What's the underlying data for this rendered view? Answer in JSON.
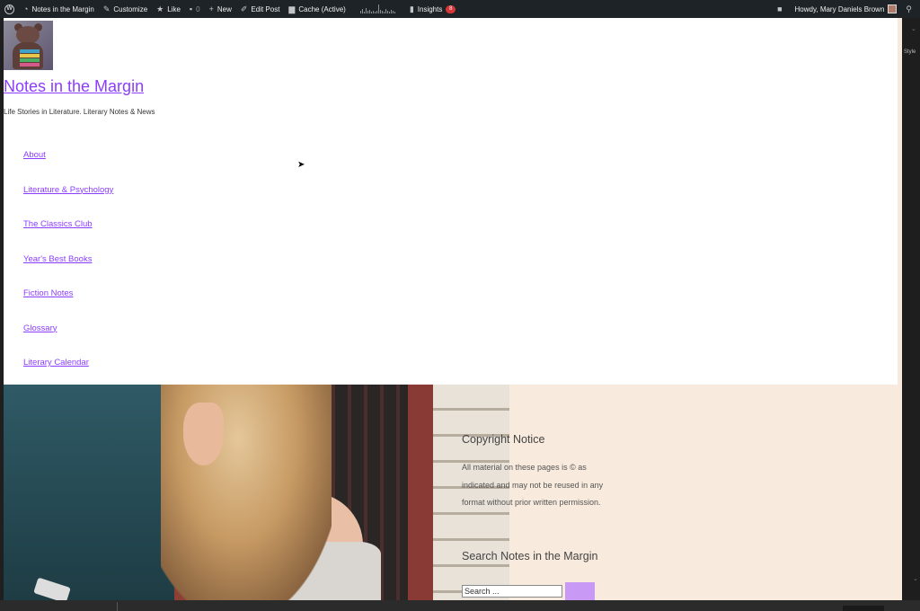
{
  "admin_bar": {
    "site_name": "Notes in the Margin",
    "customize": "Customize",
    "like": "Like",
    "comments_count": "0",
    "new": "New",
    "edit_post": "Edit Post",
    "cache": "Cache (Active)",
    "insights": "Insights",
    "insights_badge": "8",
    "greeting": "Howdy, Mary Daniels Brown",
    "background": "#1d2327"
  },
  "side_panel": {
    "tab_label": "Style"
  },
  "site": {
    "title": "Notes in the Margin",
    "tagline": "Life Stories in Literature. Literary Notes & News",
    "link_color": "#8b3dff",
    "page_background": "#f8eadc"
  },
  "nav": {
    "items": [
      {
        "label": "About"
      },
      {
        "label": "Literature & Psychology"
      },
      {
        "label": "The Classics Club"
      },
      {
        "label": "Year's Best Books"
      },
      {
        "label": "Fiction Notes"
      },
      {
        "label": "Glossary"
      },
      {
        "label": "Literary Calendar"
      }
    ]
  },
  "widgets": {
    "copyright_title": "Copyright Notice",
    "copyright_text": "All material on these pages is © as indicated and may not be reused in any format without prior written permission.",
    "search_title": "Search Notes in the Margin",
    "search_placeholder": "Search ...",
    "search_button_color": "#c899f5"
  }
}
